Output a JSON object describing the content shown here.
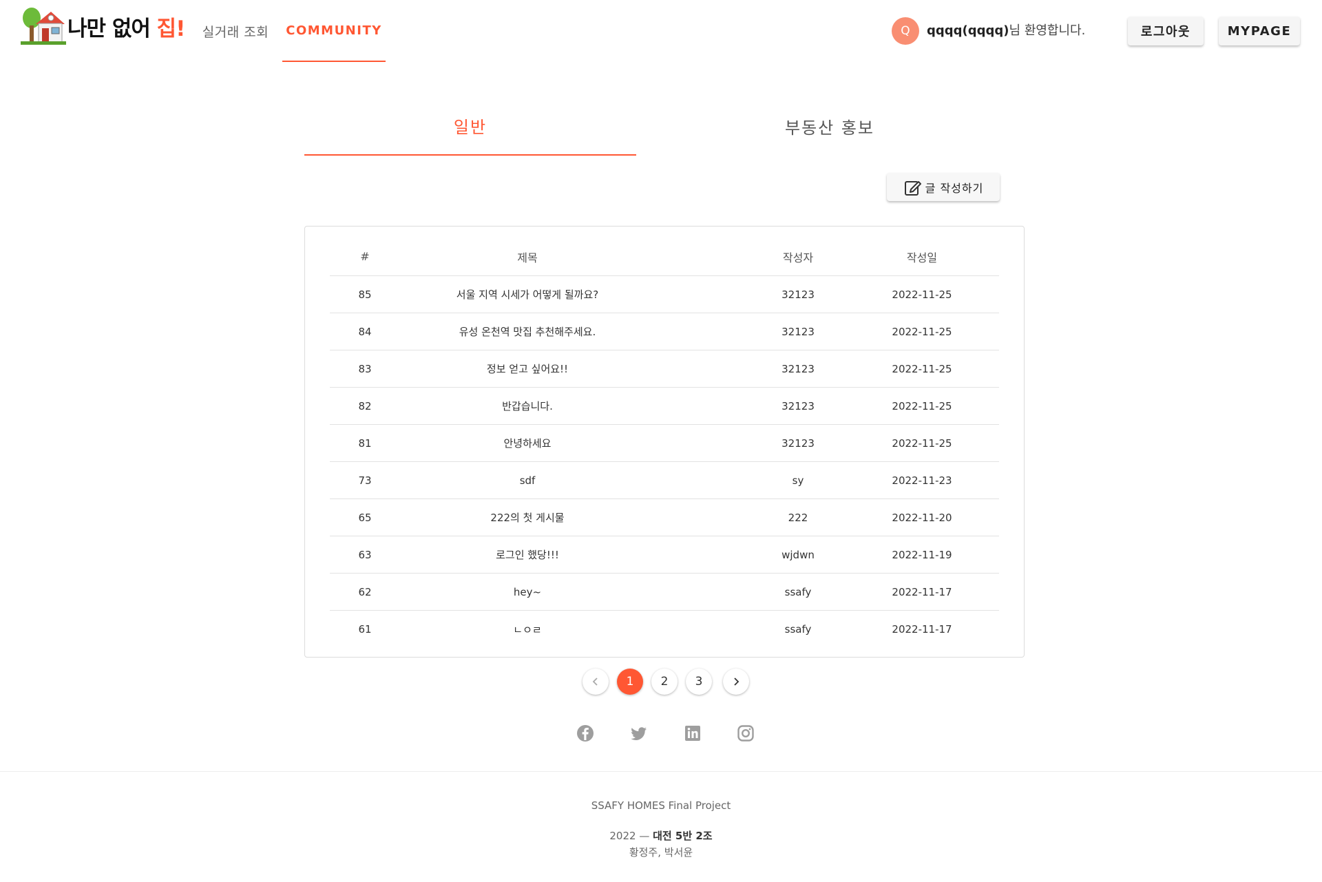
{
  "header": {
    "logo_text_main": "나만 없어 ",
    "logo_text_accent": "집!",
    "nav": [
      {
        "label": "실거래 조회"
      },
      {
        "label": "COMMUNITY"
      }
    ],
    "avatar_initial": "Q",
    "user_name": "qqqq(qqqq)",
    "welcome_suffix": "님 환영합니다.",
    "logout_label": "로그아웃",
    "mypage_label": "MYPAGE"
  },
  "tabs": [
    {
      "label": "일반"
    },
    {
      "label": "부동산 홍보"
    }
  ],
  "write_button": "글 작성하기",
  "table": {
    "columns": [
      "#",
      "제목",
      "작성자",
      "작성일"
    ],
    "rows": [
      {
        "num": "85",
        "title": "서울 지역 시세가 어떻게 될까요?",
        "author": "32123",
        "date": "2022-11-25"
      },
      {
        "num": "84",
        "title": "유성 온천역 맛집 추천해주세요.",
        "author": "32123",
        "date": "2022-11-25"
      },
      {
        "num": "83",
        "title": "정보 얻고 싶어요!!",
        "author": "32123",
        "date": "2022-11-25"
      },
      {
        "num": "82",
        "title": "반갑습니다.",
        "author": "32123",
        "date": "2022-11-25"
      },
      {
        "num": "81",
        "title": "안녕하세요",
        "author": "32123",
        "date": "2022-11-25"
      },
      {
        "num": "73",
        "title": "sdf",
        "author": "sy",
        "date": "2022-11-23"
      },
      {
        "num": "65",
        "title": "222의 첫 게시물",
        "author": "222",
        "date": "2022-11-20"
      },
      {
        "num": "63",
        "title": "로그인 했당!!!",
        "author": "wjdwn",
        "date": "2022-11-19"
      },
      {
        "num": "62",
        "title": "hey~",
        "author": "ssafy",
        "date": "2022-11-17"
      },
      {
        "num": "61",
        "title": "ㄴㅇㄹ",
        "author": "ssafy",
        "date": "2022-11-17"
      }
    ]
  },
  "pagination": {
    "pages": [
      "1",
      "2",
      "3"
    ],
    "current": "1"
  },
  "social": [
    "facebook-icon",
    "twitter-icon",
    "linkedin-icon",
    "instagram-icon"
  ],
  "footer": {
    "project": "SSAFY HOMES Final Project",
    "year": "2022",
    "dash": " — ",
    "team": "대전 5반 2조",
    "members": "황정주, 박서윤"
  },
  "colors": {
    "accent": "#ff5733",
    "avatar": "#f98e72"
  }
}
